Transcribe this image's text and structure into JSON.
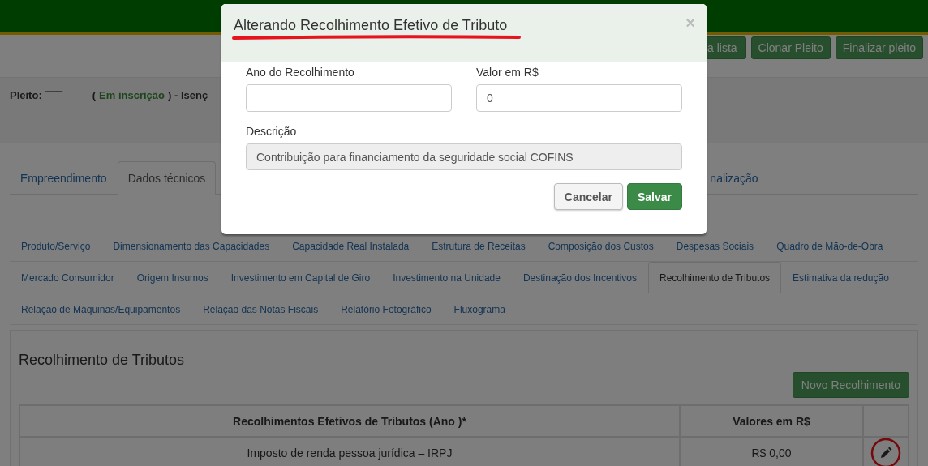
{
  "header_buttons": [
    {
      "label": "a lista"
    },
    {
      "label": "Clonar Pleito"
    },
    {
      "label": "Finalizar pleito"
    }
  ],
  "pleito": {
    "label": "Pleito:",
    "value": "¯¯¯",
    "open": "(",
    "status": "Em inscrição",
    "rest": ") - Isenç"
  },
  "tabs": [
    {
      "label": "Empreendimento",
      "selected": false
    },
    {
      "label": "Dados técnicos",
      "selected": true
    },
    {
      "label": "nalização",
      "selected": false
    }
  ],
  "subtab_rows": [
    [
      {
        "label": "Produto/Serviço",
        "selected": false
      },
      {
        "label": "Dimensionamento das Capacidades",
        "selected": false
      },
      {
        "label": "Capacidade Real Instalada",
        "selected": false
      },
      {
        "label": "Estrutura de Receitas",
        "selected": false
      },
      {
        "label": "Composição dos Custos",
        "selected": false
      },
      {
        "label": "Despesas Sociais",
        "selected": false
      },
      {
        "label": "Quadro de Mão-de-Obra",
        "selected": false
      }
    ],
    [
      {
        "label": "Mercado Consumidor",
        "selected": false
      },
      {
        "label": "Origem Insumos",
        "selected": false
      },
      {
        "label": "Investimento em Capital de Giro",
        "selected": false
      },
      {
        "label": "Investimento na Unidade",
        "selected": false
      },
      {
        "label": "Destinação dos Incentivos",
        "selected": false
      },
      {
        "label": "Recolhimento de Tributos",
        "selected": true
      },
      {
        "label": "Estimativa da redução",
        "selected": false
      }
    ],
    [
      {
        "label": "Relação de Máquinas/Equipamentos",
        "selected": false
      },
      {
        "label": "Relação das Notas Fiscais",
        "selected": false
      },
      {
        "label": "Relatório Fotográfico",
        "selected": false
      },
      {
        "label": "Fluxograma",
        "selected": false
      }
    ]
  ],
  "section": {
    "title": "Recolhimento de Tributos",
    "new_button": "Novo Recolhimento",
    "table": {
      "columns": [
        "Recolhimentos Efetivos de Tributos (Ano )*",
        "Valores em R$"
      ],
      "rows": [
        {
          "tributo": "Imposto de renda pessoa jurídica – IRPJ",
          "valor": "R$ 0,00",
          "edit_circled": true
        }
      ]
    }
  },
  "modal": {
    "title": "Alterando Recolhimento Efetivo de Tributo",
    "title_underlined": true,
    "close": "×",
    "fields": [
      {
        "label": "Ano do Recolhimento"
      },
      {
        "label": "Valor em R$",
        "value": "0"
      }
    ],
    "description": {
      "label": "Descrição",
      "value": "Contribuição para financiamento da seguridade social COFINS",
      "disabled": true
    },
    "buttons": [
      {
        "label": "Cancelar",
        "kind": "default"
      },
      {
        "label": "Salvar",
        "kind": "primary"
      }
    ]
  }
}
